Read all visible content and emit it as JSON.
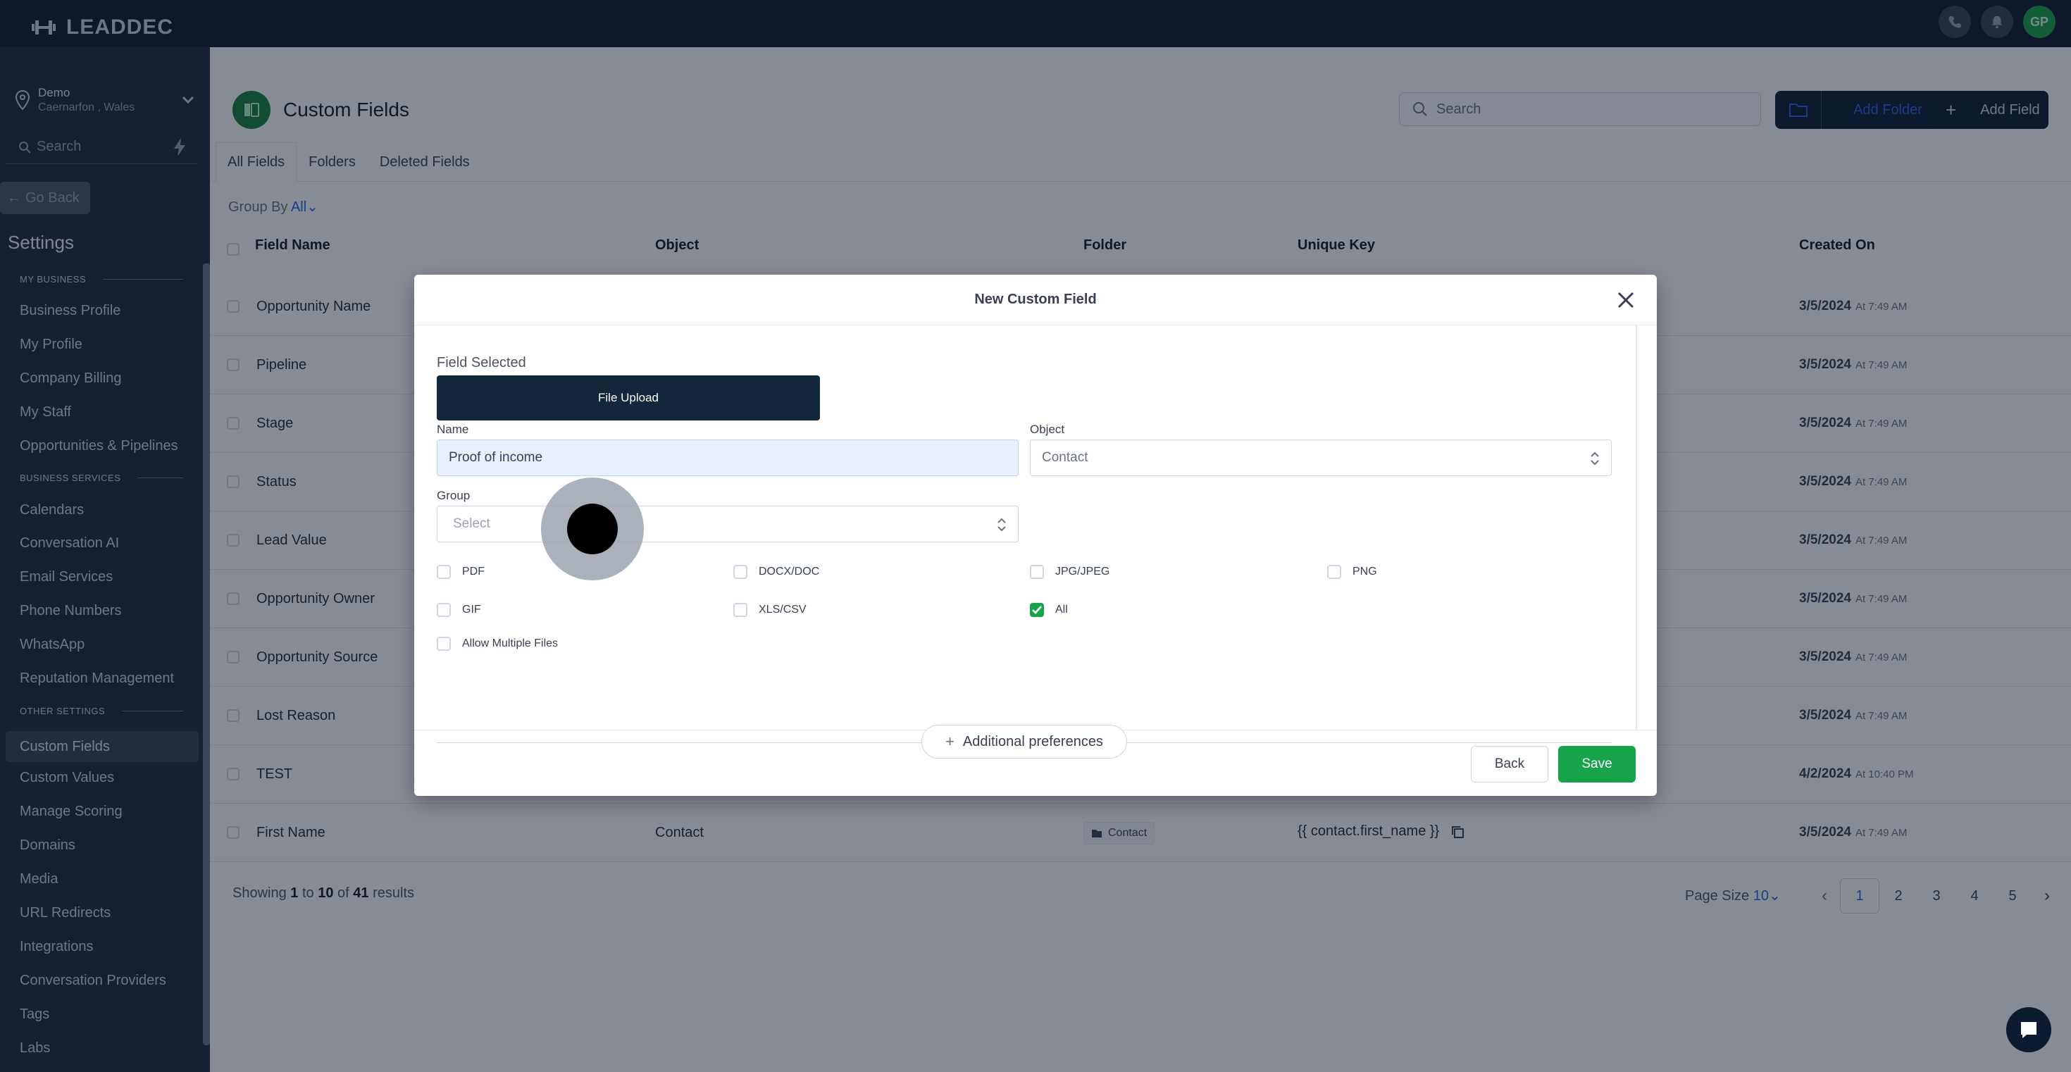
{
  "brand": {
    "name": "LEADDEC"
  },
  "topbar": {
    "avatar_initials": "GP"
  },
  "account": {
    "name": "Demo",
    "location": "Caernarfon , Wales"
  },
  "sidebar": {
    "search_placeholder": "Search",
    "go_back": "Go Back",
    "settings_title": "Settings",
    "sections": {
      "my_business": "MY BUSINESS",
      "business_services": "BUSINESS SERVICES",
      "other_settings": "OTHER SETTINGS"
    },
    "my_business_items": [
      "Business Profile",
      "My Profile",
      "Company Billing",
      "My Staff",
      "Opportunities & Pipelines"
    ],
    "business_services_items": [
      "Calendars",
      "Conversation AI",
      "Email Services",
      "Phone Numbers",
      "WhatsApp",
      "Reputation Management"
    ],
    "other_settings_items": [
      "Custom Fields",
      "Custom Values",
      "Manage Scoring",
      "Domains",
      "Media",
      "URL Redirects",
      "Integrations",
      "Conversation Providers",
      "Tags",
      "Labs"
    ]
  },
  "page": {
    "title": "Custom Fields",
    "search_placeholder": "Search",
    "add_folder": "Add Folder",
    "add_field": "Add Field",
    "tabs": [
      "All Fields",
      "Folders",
      "Deleted Fields"
    ],
    "group_by_label": "Group By",
    "group_by_value": "All",
    "columns": [
      "Field Name",
      "Object",
      "Folder",
      "Unique Key",
      "Created On"
    ],
    "rows": [
      {
        "name": "Opportunity Name",
        "date": "3/5/2024",
        "time": "At 7:49 AM"
      },
      {
        "name": "Pipeline",
        "date": "3/5/2024",
        "time": "At 7:49 AM"
      },
      {
        "name": "Stage",
        "date": "3/5/2024",
        "time": "At 7:49 AM"
      },
      {
        "name": "Status",
        "date": "3/5/2024",
        "time": "At 7:49 AM"
      },
      {
        "name": "Lead Value",
        "date": "3/5/2024",
        "time": "At 7:49 AM"
      },
      {
        "name": "Opportunity Owner",
        "date": "3/5/2024",
        "time": "At 7:49 AM"
      },
      {
        "name": "Opportunity Source",
        "date": "3/5/2024",
        "time": "At 7:49 AM"
      },
      {
        "name": "Lost Reason",
        "date": "3/5/2024",
        "time": "At 7:49 AM"
      },
      {
        "name": "TEST",
        "date": "4/2/2024",
        "time": "At 10:40 PM"
      },
      {
        "name": "First Name",
        "object": "Contact",
        "folder": "Contact",
        "unique_key": "{{ contact.first_name }}",
        "date": "3/5/2024",
        "time": "At 7:49 AM"
      }
    ],
    "showing": {
      "prefix": "Showing",
      "from": "1",
      "to_word": "to",
      "to": "10",
      "of_word": "of",
      "total": "41",
      "suffix": "results"
    },
    "page_size_label": "Page Size",
    "page_size_value": "10",
    "pages": [
      "1",
      "2",
      "3",
      "4",
      "5"
    ]
  },
  "modal": {
    "title": "New Custom Field",
    "field_selected_label": "Field Selected",
    "field_type": "File Upload",
    "name_label": "Name",
    "name_value": "Proof of income",
    "object_label": "Object",
    "object_value": "Contact",
    "group_label": "Group",
    "group_placeholder": "Select",
    "file_types": [
      {
        "label": "PDF",
        "checked": false
      },
      {
        "label": "DOCX/DOC",
        "checked": false
      },
      {
        "label": "JPG/JPEG",
        "checked": false
      },
      {
        "label": "PNG",
        "checked": false
      },
      {
        "label": "GIF",
        "checked": false
      },
      {
        "label": "XLS/CSV",
        "checked": false
      },
      {
        "label": "All",
        "checked": true
      }
    ],
    "allow_multiple_label": "Allow Multiple Files",
    "additional_preferences": "Additional preferences",
    "back": "Back",
    "save": "Save"
  },
  "colors": {
    "accent_green": "#16a34a",
    "navy": "#0f172a",
    "link_blue": "#2563eb"
  }
}
